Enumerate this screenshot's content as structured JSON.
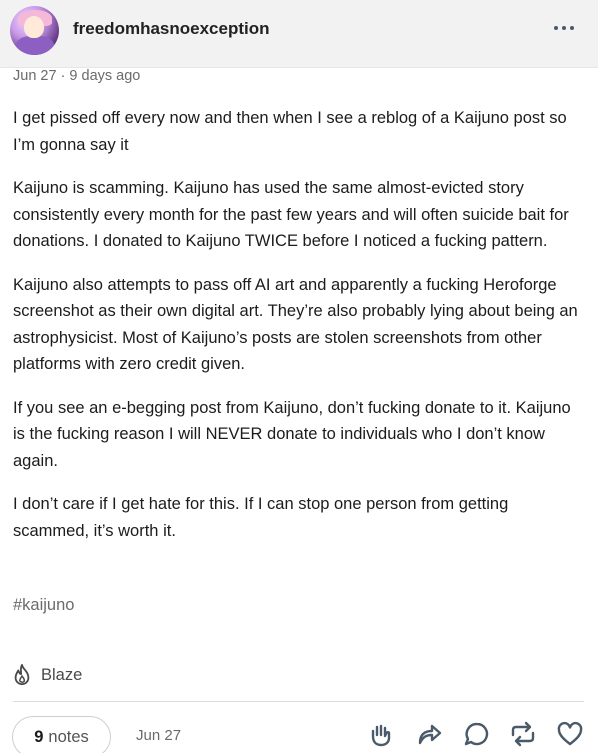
{
  "post": {
    "username": "freedomhasnoexception",
    "date": "Jun 27 · 9 days ago",
    "paragraphs": [
      "I get pissed off every now and then when I see a reblog of a Kaijuno post so I’m gonna say it",
      "Kaijuno is scamming. Kaijuno has used the same almost-evicted story consistently every month for the past few years and will often suicide bait for donations. I donated to Kaijuno TWICE before I noticed a fucking pattern.",
      "Kaijuno also attempts to pass off AI art and apparently a fucking Heroforge screenshot as their own digital art. They’re also probably lying about being an astrophysicist. Most of Kaijuno’s posts are stolen screenshots from other platforms with zero credit given.",
      "If you see an e-begging post from Kaijuno, don’t fucking donate to it. Kaijuno is the fucking reason I will NEVER donate to individuals who I don’t know again.",
      "I don’t care if I get hate for this. If I can stop one person from getting scammed, it’s worth it."
    ],
    "tag": "#kaijuno"
  },
  "blaze": {
    "label": "Blaze"
  },
  "footer": {
    "notes_count": "9",
    "notes_label": "notes",
    "date": "Jun 27"
  },
  "icons": {
    "more": "ellipsis-icon",
    "blaze": "flame-icon",
    "tip": "hand-icon",
    "share": "share-arrow-icon",
    "reply": "speech-bubble-icon",
    "reblog": "reblog-icon",
    "like": "heart-icon"
  },
  "colors": {
    "text": "#1c1c1c",
    "muted": "#6b6b6b",
    "icon": "#4a5a6a",
    "header_bg": "#f2f2f2"
  }
}
